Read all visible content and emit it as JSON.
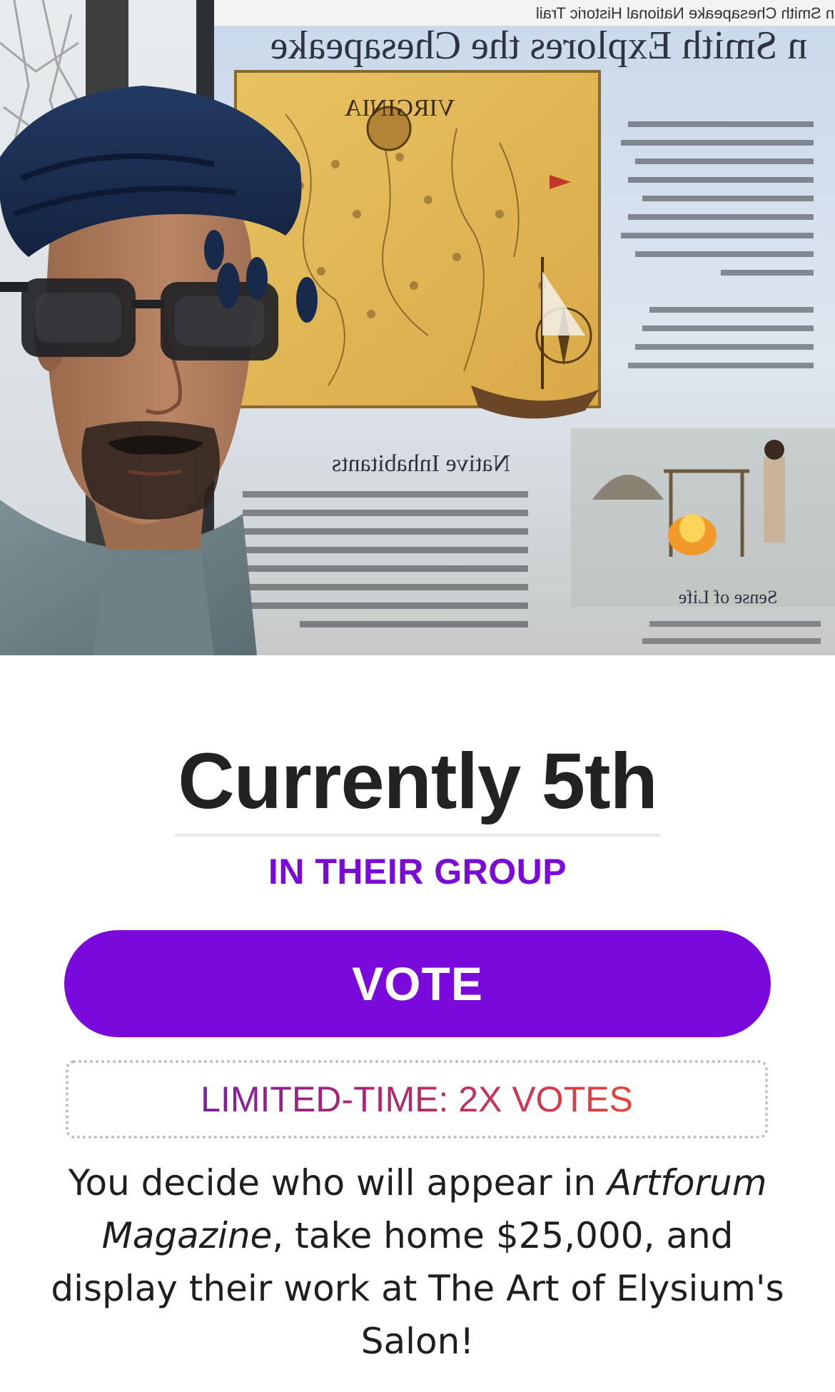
{
  "photo": {
    "sign_header": "n Smith Chesapeake National Historic Trail",
    "sign_title": "n Smith Explores the Chesapeake",
    "section_heading": "Native Inhabitants",
    "section_heading_2": "Sense of Life",
    "map_label": "VIRGINIA"
  },
  "rank": {
    "title": "Currently 5th",
    "subtitle": "IN THEIR GROUP"
  },
  "vote": {
    "label": "VOTE",
    "color": "#7a0adb"
  },
  "promo": {
    "label": "LIMITED-TIME: 2X VOTES"
  },
  "description": {
    "part1": "You decide who will appear in ",
    "magazine": "Artforum Magazine",
    "part2": ", take home $25,000, and display their work at The Art of Elysium's Salon!"
  }
}
